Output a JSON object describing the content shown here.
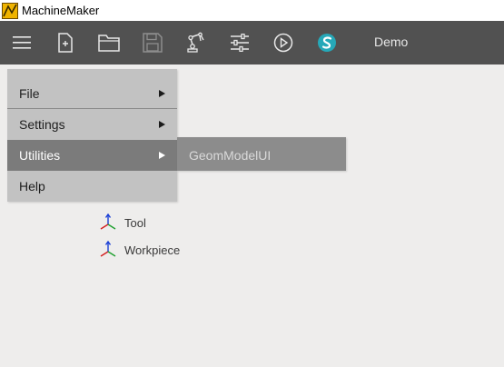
{
  "window": {
    "title": "MachineMaker"
  },
  "toolbar": {
    "buttons": [
      {
        "icon": "hamburger-menu-icon"
      },
      {
        "icon": "new-file-icon"
      },
      {
        "icon": "open-folder-icon"
      },
      {
        "icon": "save-icon"
      },
      {
        "icon": "robot-arm-icon"
      },
      {
        "icon": "sliders-icon"
      },
      {
        "icon": "play-icon"
      },
      {
        "icon": "app-logo-icon"
      }
    ],
    "project_name": "Demo"
  },
  "menu": {
    "items": [
      {
        "label": "File",
        "has_submenu": true
      },
      {
        "label": "Settings",
        "has_submenu": true
      },
      {
        "label": "Utilities",
        "has_submenu": true,
        "active": true
      },
      {
        "label": "Help",
        "has_submenu": false
      }
    ],
    "submenu": {
      "items": [
        {
          "label": "GeomModelUI"
        }
      ]
    }
  },
  "tree": {
    "items": [
      {
        "label": "Tool",
        "icon": "coordinate-frame-icon"
      },
      {
        "label": "Workpiece",
        "icon": "coordinate-frame-icon"
      }
    ]
  },
  "colors": {
    "toolbar_bg": "#515151",
    "menu_bg": "#c2c2c2",
    "menu_active_bg": "#7b7b7b",
    "submenu_bg": "#8c8c8c",
    "logo_accent": "#26a8b8"
  }
}
